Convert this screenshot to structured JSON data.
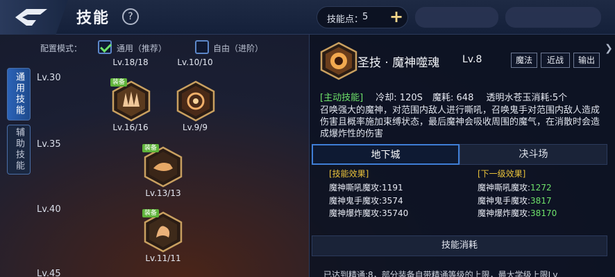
{
  "header": {
    "title": "技能",
    "help_label": "?",
    "skill_points_label": "技能点：",
    "skill_points_value": "5",
    "add_label": "+"
  },
  "config": {
    "label": "配置模式：",
    "option_general": "通用（推荐）",
    "option_free": "自由（进阶）"
  },
  "side_tabs": {
    "general": "通用技能",
    "support": "辅助技能"
  },
  "levels": [
    "Lv.30",
    "Lv.35",
    "Lv.40",
    "Lv.45"
  ],
  "skills": {
    "top_left_lv": "Lv.18/18",
    "top_right_lv": "Lv.10/10",
    "s1_badge": "装备",
    "s1_lv": "Lv.16/16",
    "s2_lv": "Lv.9/9",
    "s3_badge": "装备",
    "s3_lv": "Lv.13/13",
    "s4_badge": "装备",
    "s4_lv": "Lv.11/11"
  },
  "detail": {
    "name": "圣技 · 魔神噬魂",
    "level": "Lv.8",
    "tag_magic": "魔法",
    "tag_melee": "近战",
    "tag_output": "输出",
    "active_tag": "[主动技能]",
    "cooldown": "冷却: 120S",
    "mana": "魔耗: 648",
    "consume": "透明水苍玉消耗:5个",
    "description": "召唤强大的魔神，对范围内敌人进行嘶吼，召唤鬼手对范围内敌人造成伤害且概率施加束缚状态，最后魔神会吸收周围的魔气，在消散时会造成爆炸性的伤害"
  },
  "mode_tabs": {
    "dungeon": "地下城",
    "arena": "决斗场"
  },
  "effects": {
    "current_head": "[技能效果]",
    "next_head": "[下一级效果]",
    "current": [
      {
        "label": "魔神嘶吼魔攻:",
        "value": "1191"
      },
      {
        "label": "魔神鬼手魔攻:",
        "value": "3574"
      },
      {
        "label": "魔神爆炸魔攻:",
        "value": "35740"
      }
    ],
    "next": [
      {
        "label": "魔神嘶吼魔攻:",
        "value": "1272"
      },
      {
        "label": "魔神鬼手魔攻:",
        "value": "3817"
      },
      {
        "label": "魔神爆炸魔攻:",
        "value": "38170"
      }
    ]
  },
  "consume_bar": "技能消耗",
  "cutoff_text": "已达到精通:8，部分装备自带精通等级的上限，最大学级上限Lv"
}
